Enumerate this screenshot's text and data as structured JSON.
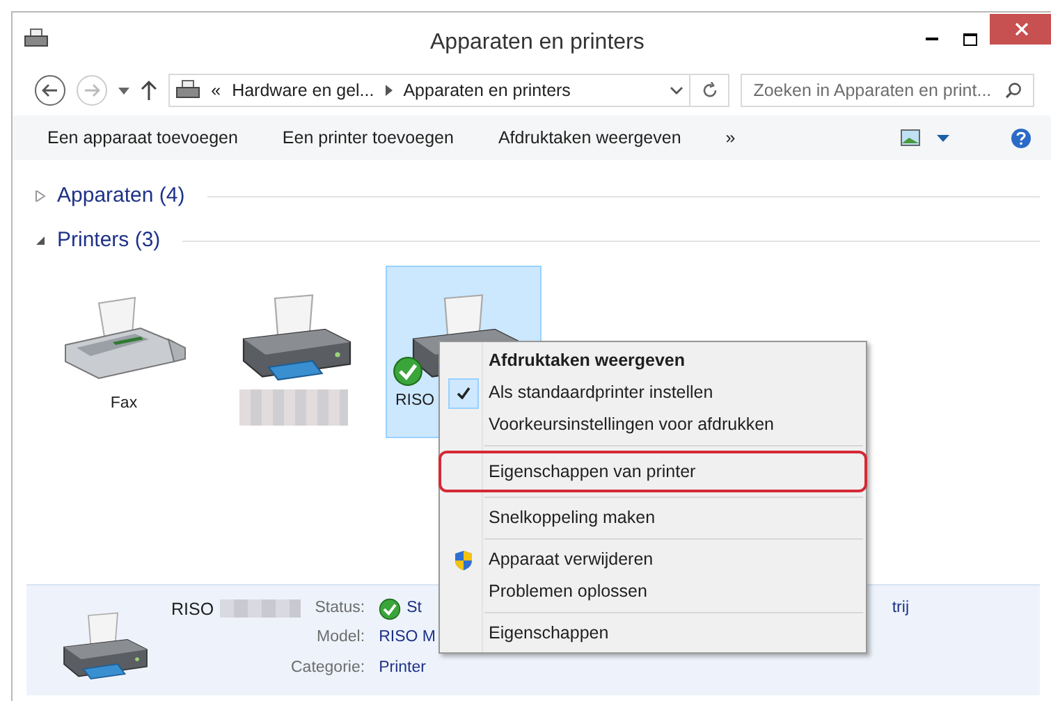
{
  "window": {
    "title": "Apparaten en printers"
  },
  "address_bar": {
    "breadcrumbs": [
      "«",
      "Hardware en gel...",
      "Apparaten en printers"
    ]
  },
  "search": {
    "placeholder": "Zoeken in Apparaten en print..."
  },
  "commands": [
    {
      "label": "Een apparaat toevoegen"
    },
    {
      "label": "Een printer toevoegen"
    },
    {
      "label": "Afdruktaken weergeven"
    },
    {
      "label": "»"
    }
  ],
  "groups": [
    {
      "label": "Apparaten (4)",
      "expanded": false
    },
    {
      "label": "Printers (3)",
      "expanded": true
    }
  ],
  "printers": [
    {
      "kind": "fax",
      "label": "Fax",
      "name_blurred": false,
      "selected": false,
      "default": false
    },
    {
      "kind": "printer",
      "name_blurred": true,
      "selected": false,
      "default": false
    },
    {
      "kind": "printer",
      "label": "RISO",
      "name_blurred": false,
      "selected": true,
      "default": true
    }
  ],
  "context_menu": [
    [
      {
        "label": "Afdruktaken weergeven",
        "bold": true,
        "checked": false,
        "highlighted": false
      },
      {
        "label": "Als standaardprinter instellen",
        "bold": false,
        "checked": true,
        "highlighted": false
      },
      {
        "label": "Voorkeursinstellingen voor afdrukken",
        "bold": false,
        "checked": false,
        "highlighted": false
      }
    ],
    [
      {
        "label": "Eigenschappen van printer",
        "bold": false,
        "checked": false,
        "highlighted": true
      }
    ],
    [
      {
        "label": "Snelkoppeling maken",
        "bold": false,
        "checked": false,
        "highlighted": false
      }
    ],
    [
      {
        "label": "Apparaat verwijderen",
        "bold": false,
        "checked": false,
        "highlighted": false,
        "kind": "shield"
      },
      {
        "label": "Problemen oplossen",
        "bold": false,
        "checked": false,
        "highlighted": false
      }
    ],
    [
      {
        "label": "Eigenschappen",
        "bold": false,
        "checked": false,
        "highlighted": false
      }
    ]
  ],
  "details": {
    "name": "RISO",
    "name_blurred": true,
    "fields": [
      {
        "label": "Status:",
        "value": "St",
        "ok": true
      },
      {
        "label": "Model:",
        "value": "RISO M",
        "ok": false
      },
      {
        "label": "Categorie:",
        "value": "Printer",
        "ok": false
      }
    ],
    "extra": "trij"
  }
}
